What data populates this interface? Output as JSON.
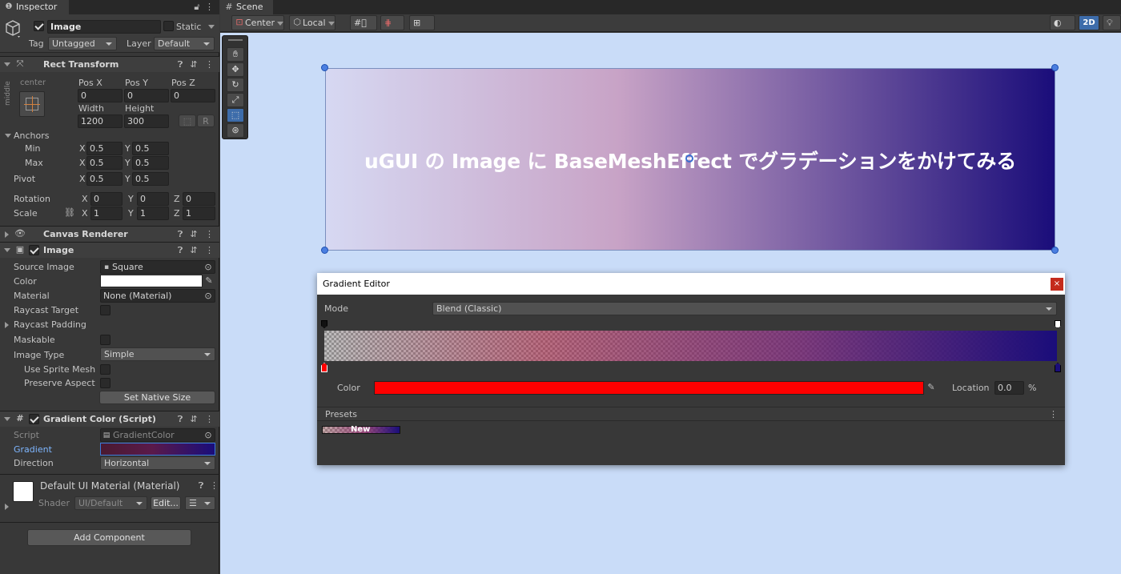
{
  "inspector": {
    "tab": "Inspector",
    "object": {
      "name": "Image",
      "static_label": "Static",
      "tag_label": "Tag",
      "tag": "Untagged",
      "layer_label": "Layer",
      "layer": "Default"
    },
    "rect_transform": {
      "title": "Rect Transform",
      "anchor_h": "center",
      "anchor_v": "middle",
      "posx_label": "Pos X",
      "posy_label": "Pos Y",
      "posz_label": "Pos Z",
      "posx": "0",
      "posy": "0",
      "posz": "0",
      "width_label": "Width",
      "height_label": "Height",
      "width": "1200",
      "height": "300",
      "r_label": "R",
      "anchors_label": "Anchors",
      "min_label": "Min",
      "max_label": "Max",
      "min_x": "0.5",
      "min_y": "0.5",
      "max_x": "0.5",
      "max_y": "0.5",
      "pivot_label": "Pivot",
      "pivot_x": "0.5",
      "pivot_y": "0.5",
      "rotation_label": "Rotation",
      "rot_x": "0",
      "rot_y": "0",
      "rot_z": "0",
      "scale_label": "Scale",
      "scale_x": "1",
      "scale_y": "1",
      "scale_z": "1",
      "x": "X",
      "y": "Y",
      "z": "Z"
    },
    "canvas_renderer": {
      "title": "Canvas Renderer"
    },
    "image": {
      "title": "Image",
      "source_label": "Source Image",
      "source": "Square",
      "color_label": "Color",
      "material_label": "Material",
      "material": "None (Material)",
      "raycast_label": "Raycast Target",
      "padding_label": "Raycast Padding",
      "maskable_label": "Maskable",
      "type_label": "Image Type",
      "type": "Simple",
      "sprite_mesh_label": "Use Sprite Mesh",
      "preserve_label": "Preserve Aspect",
      "native_button": "Set Native Size"
    },
    "gradient_color": {
      "title": "Gradient Color (Script)",
      "script_label": "Script",
      "script": "GradientColor",
      "gradient_label": "Gradient",
      "direction_label": "Direction",
      "direction": "Horizontal"
    },
    "material": {
      "title": "Default UI Material (Material)",
      "shader_label": "Shader",
      "shader": "UI/Default",
      "edit_button": "Edit..."
    },
    "add_component": "Add Component"
  },
  "scene": {
    "tab": "Scene",
    "pivot_mode": "Center",
    "space_mode": "Local",
    "mode_2d": "2D",
    "banner_text": "uGUI の Image に BaseMeshEffect でグラデーションをかけてみる",
    "background_color": "#c9dcf8",
    "gradient_start": "#d6d8f2",
    "gradient_mid": "#c8a3c6",
    "gradient_end": "#1a0d7a"
  },
  "gradient_editor": {
    "title": "Gradient Editor",
    "close": "×",
    "mode_label": "Mode",
    "mode": "Blend (Classic)",
    "color_label": "Color",
    "color_value": "#ff0000",
    "location_label": "Location",
    "location": "0.0",
    "percent": "%",
    "presets_label": "Presets",
    "preset_new": "New"
  }
}
